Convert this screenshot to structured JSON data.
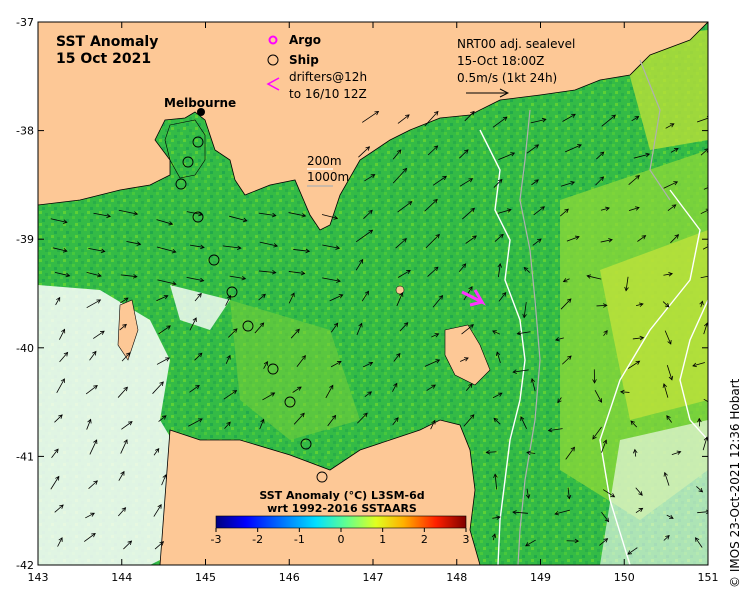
{
  "title": {
    "line1": "SST Anomaly",
    "line2": "15 Oct 2021"
  },
  "legend_symbols": {
    "argo": "Argo",
    "ship": "Ship",
    "drifters_line1": "drifters@12h",
    "drifters_line2": "to 16/10 12Z"
  },
  "sealevel_info": {
    "line1": "NRT00 adj. sealevel",
    "line2": "15-Oct 18:00Z",
    "line3": "0.5m/s (1kt 24h)"
  },
  "isobaths": {
    "label1": "200m",
    "label2": "1000m"
  },
  "place_label": "Melbourne",
  "colorbar": {
    "title_line1": "SST Anomaly (°C) L3SM-6d",
    "title_line2": "wrt 1992-2016 SSTAARS",
    "ticks": [
      "-3",
      "-2",
      "-1",
      "0",
      "1",
      "2",
      "3"
    ],
    "colors": [
      "#00007f",
      "#0000ff",
      "#0080ff",
      "#00ffff",
      "#80ff80",
      "#ffff00",
      "#ff8000",
      "#ff0000",
      "#7f0000"
    ]
  },
  "axes": {
    "x_ticks": [
      "143",
      "144",
      "145",
      "146",
      "147",
      "148",
      "149",
      "150",
      "151"
    ],
    "y_ticks": [
      "-37",
      "-38",
      "-39",
      "-40",
      "-41",
      "-42"
    ]
  },
  "credit": "© IMOS 23-Oct-2021 12:36 Hobart",
  "colors": {
    "land": "#fdc896",
    "sea_base": "#2db84a",
    "argo_marker": "#ff00ff",
    "drifter": "#ff33ff"
  }
}
